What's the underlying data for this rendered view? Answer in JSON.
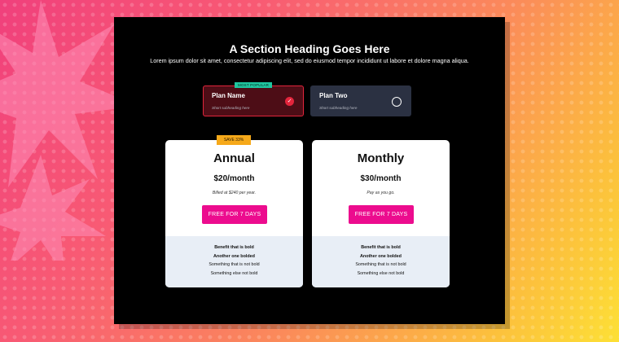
{
  "section": {
    "heading": "A Section Heading Goes Here",
    "lede": "Lorem ipsum dolor sit amet, consectetur adipiscing elit, sed do eiusmod tempor incididunt ut labore et dolore magna aliqua."
  },
  "plans": [
    {
      "name": "Plan Name",
      "subheading": "Short subheading here",
      "badge": "MOST POPULAR",
      "selected": true
    },
    {
      "name": "Plan Two",
      "subheading": "Short subheading here",
      "selected": false
    }
  ],
  "cards": {
    "annual": {
      "tag": "SAVE 33%",
      "title": "Annual",
      "price": "$20/month",
      "note": "Billed at $240 per year.",
      "cta": "FREE FOR 7 DAYS",
      "benefits": [
        "Benefit that is bold",
        "Another one bolded",
        "Something that is not bold",
        "Something else not bold"
      ]
    },
    "monthly": {
      "title": "Monthly",
      "price": "$30/month",
      "note": "Pay as you go.",
      "cta": "FREE FOR 7 DAYS",
      "benefits": [
        "Benefit that is bold",
        "Another one bolded",
        "Something that is not bold",
        "Something else not bold"
      ]
    }
  },
  "colors": {
    "accent": "#ec0c8e",
    "selected_border": "#e3253c",
    "popular_badge": "#1fc6a0",
    "save_tag": "#f6a91a"
  }
}
